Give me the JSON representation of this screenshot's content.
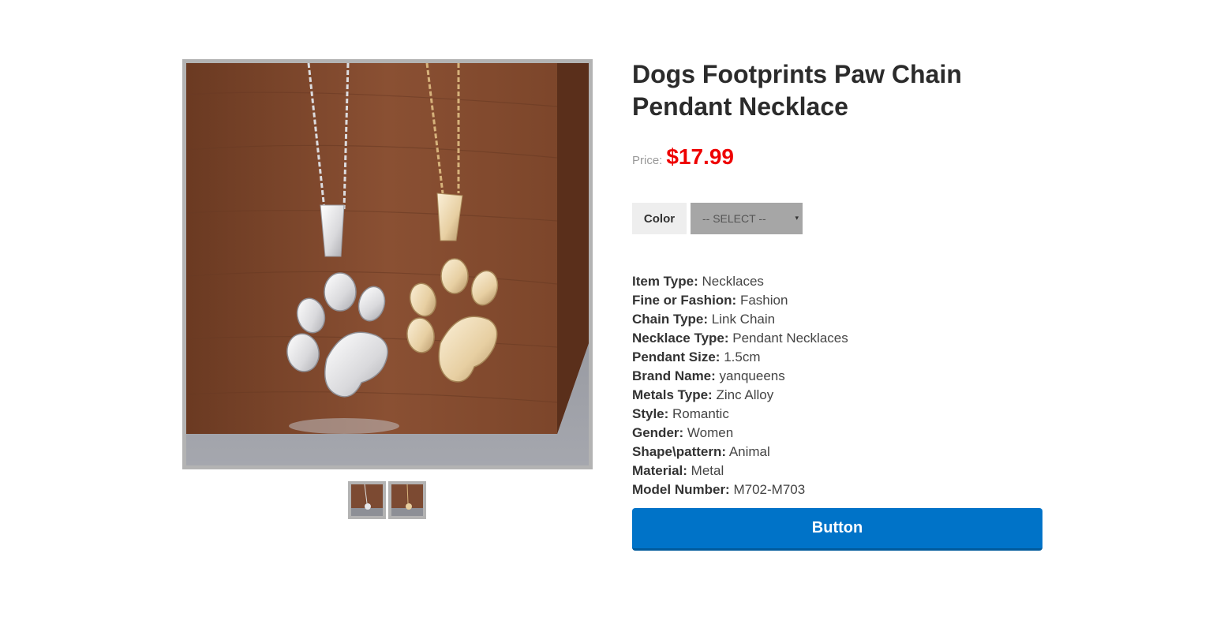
{
  "product": {
    "title": "Dogs Footprints Paw Chain Pendant Necklace",
    "price_label": "Price:",
    "price": "$17.99"
  },
  "option": {
    "label": "Color",
    "selected": "-- SELECT --",
    "arrow": "▾"
  },
  "specs": [
    {
      "key": "Item Type:",
      "value": "Necklaces"
    },
    {
      "key": "Fine or Fashion:",
      "value": "Fashion"
    },
    {
      "key": "Chain Type:",
      "value": "Link Chain"
    },
    {
      "key": "Necklace Type:",
      "value": "Pendant Necklaces"
    },
    {
      "key": "Pendant Size:",
      "value": "1.5cm"
    },
    {
      "key": "Brand Name:",
      "value": "yanqueens"
    },
    {
      "key": "Metals Type:",
      "value": "Zinc Alloy"
    },
    {
      "key": "Style:",
      "value": "Romantic"
    },
    {
      "key": "Gender:",
      "value": "Women"
    },
    {
      "key": "Shape\\pattern:",
      "value": "Animal"
    },
    {
      "key": "Material:",
      "value": "Metal"
    },
    {
      "key": "Model Number:",
      "value": "M702-M703"
    }
  ],
  "button": {
    "label": "Button"
  },
  "colors": {
    "price": "#ee0000",
    "button": "#0073c8",
    "image_border": "#b3b3b3",
    "select_bg": "#a6a6a6"
  },
  "icons": {
    "select_arrow": "chevron-down-icon"
  }
}
